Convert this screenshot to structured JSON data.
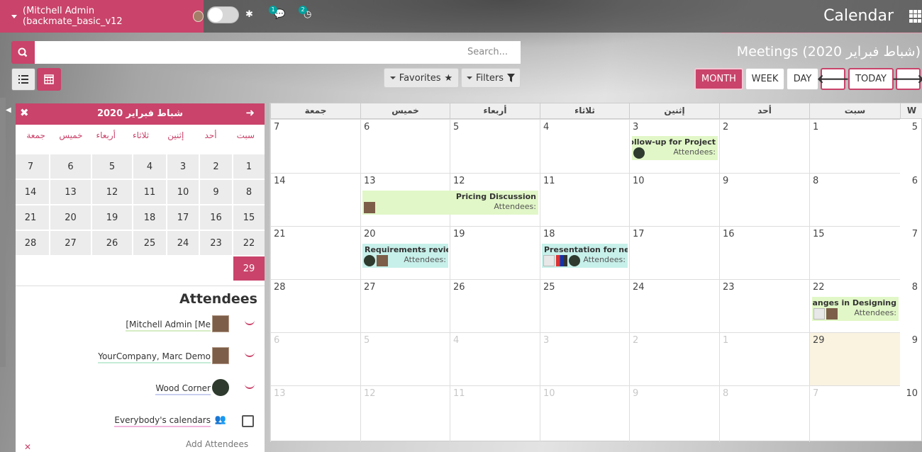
{
  "topbar": {
    "user": "(Mitchell Admin (backmate_basic_v12",
    "chat_badge": "1",
    "activity_badge": "2",
    "app_title": "Calendar"
  },
  "search": {
    "placeholder": "Search..."
  },
  "page_title": "Meetings (شباط فبراير 2020)",
  "filters": {
    "favorites": "Favorites",
    "filters": "Filters"
  },
  "scales": {
    "month": "MONTH",
    "week": "WEEK",
    "day": "DAY",
    "today": "TODAY"
  },
  "mini_calendar": {
    "title": "شباط فبراير 2020",
    "day_names": [
      "سبت",
      "أحد",
      "إثنين",
      "ثلاثاء",
      "أربعاء",
      "خميس",
      "جمعة"
    ],
    "rows": [
      [
        "1",
        "2",
        "3",
        "4",
        "5",
        "6",
        "7"
      ],
      [
        "8",
        "9",
        "10",
        "11",
        "12",
        "13",
        "14"
      ],
      [
        "15",
        "16",
        "17",
        "18",
        "19",
        "20",
        "21"
      ],
      [
        "22",
        "23",
        "24",
        "25",
        "26",
        "27",
        "28"
      ],
      [
        "29",
        "",
        "",
        "",
        "",
        "",
        ""
      ]
    ],
    "today": "29"
  },
  "attendees": {
    "title": "Attendees",
    "items": [
      {
        "name": "[Mitchell Admin [Me",
        "underline": "#d6ecc4"
      },
      {
        "name": "YourCompany, Marc Demo",
        "underline": "#c5ecd6"
      },
      {
        "name": "Wood Corner",
        "underline": "#c9cfef"
      },
      {
        "name": "Everybody's calendars",
        "underline": "#f1b5dc"
      }
    ],
    "add_label": "Add Attendees"
  },
  "calendar": {
    "week_label": "W",
    "day_headers": [
      "سبت",
      "أحد",
      "إثنين",
      "ثلاثاء",
      "أربعاء",
      "خميس",
      "جمعة"
    ],
    "weeks": [
      {
        "num": "5",
        "days": [
          "1",
          "2",
          "3",
          "4",
          "5",
          "6",
          "7"
        ]
      },
      {
        "num": "6",
        "days": [
          "8",
          "9",
          "10",
          "11",
          "12",
          "13",
          "14"
        ]
      },
      {
        "num": "7",
        "days": [
          "15",
          "16",
          "17",
          "18",
          "19",
          "20",
          "21"
        ]
      },
      {
        "num": "8",
        "days": [
          "22",
          "23",
          "24",
          "25",
          "26",
          "27",
          "28"
        ]
      },
      {
        "num": "9",
        "days": [
          "29",
          "1",
          "2",
          "3",
          "4",
          "5",
          "6"
        ]
      },
      {
        "num": "10",
        "days": [
          "7",
          "8",
          "9",
          "10",
          "11",
          "12",
          "13"
        ]
      }
    ],
    "events": [
      {
        "title": "Follow-up for Project",
        "attendees_label": "Attendees:"
      },
      {
        "title": "Pricing Discussion",
        "attendees_label": "Attendees:"
      },
      {
        "title": "Requirements review",
        "attendees_label": "Attendees:"
      },
      {
        "title": "Presentation for new",
        "attendees_label": "Attendees:"
      },
      {
        "title": "Changes in Designing",
        "attendees_label": "Attendees:"
      }
    ]
  },
  "colors": {
    "accent": "#c9436a",
    "event_green": "#e1f7c7",
    "event_teal": "#c7f0ea",
    "today_cell": "#faf3e0"
  }
}
